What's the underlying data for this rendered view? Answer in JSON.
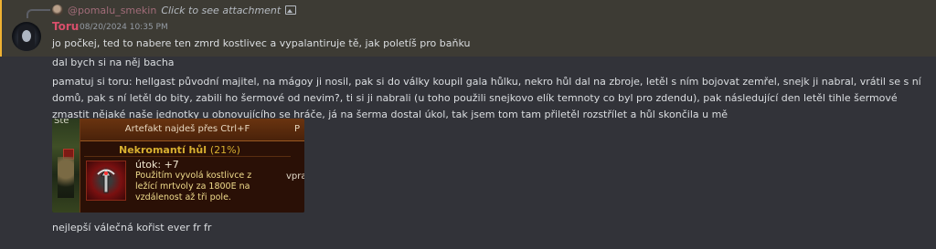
{
  "reply": {
    "username": "@pomalu_smekin",
    "text": "Click to see attachment",
    "icon": "image-icon"
  },
  "message": {
    "author": "Toru",
    "timestamp": "08/20/2024 10:35 PM",
    "lines": [
      "jo počkej, ted to nabere ten zmrd kostlivec a vypalantiruje tě, jak poletíš pro baňku",
      "dal bych si na něj bacha",
      "pamatuj si toru: hellgast původní majitel, na mágoy ji nosil, pak si do války koupil gala hůlku, nekro hůl dal na zbroje, letěl s ním bojovat zemřel, snejk ji nabral, vrátil se s ní domů, pak s ní letěl do bity, zabili ho šermové od nevim?, ti si ji nabrali (u toho použili snejkovo elík temnoty co byl pro zdendu), pak následující den letěl tihle šermové zmastit nějaké naše jednotky u obnovujícího se hráče, já na šerma dostal úkol, tak jsem tom tam přiletěl rozstřílet a hůl skončila u mě",
      "nejlepší válečná kořist ever fr fr"
    ]
  },
  "attachment": {
    "left_text": "Ste",
    "header": "Artefakt najdeš přes Ctrl+F",
    "item_name": "Nekromantí hůl",
    "item_pct": "(21%)",
    "stat": "útok: +7",
    "description": "Použitím vyvolá kostlivce z ležící mrtvoly za 1800E na vzdálenost až tři pole.",
    "side_header": "P",
    "side_text": "vpra"
  },
  "colors": {
    "highlight_bar": "#f0b232",
    "author": "#d94f6b",
    "item_name": "#d8b030"
  }
}
